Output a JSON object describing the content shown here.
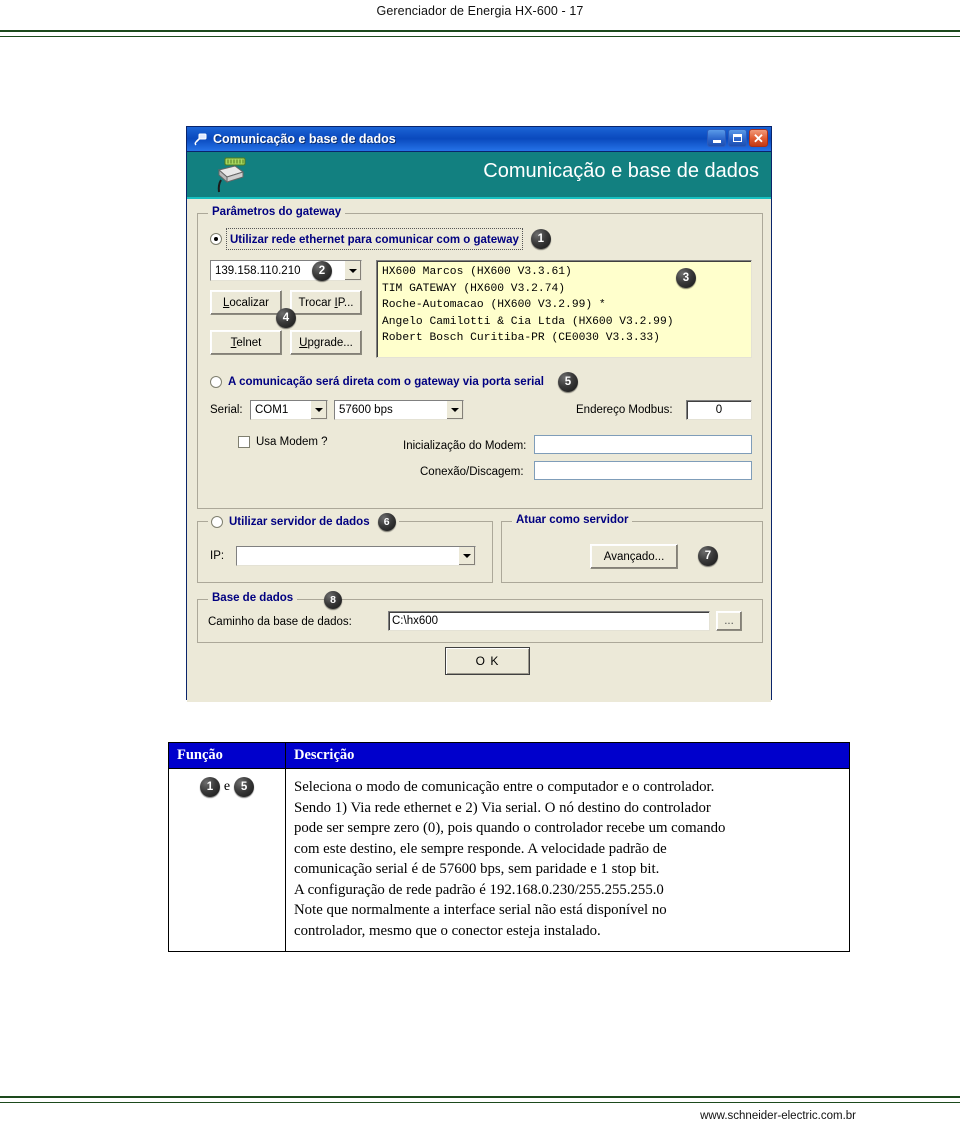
{
  "page": {
    "header_title": "Gerenciador de Energia HX-600 - 17",
    "footer_url": "www.schneider-electric.com.br"
  },
  "dialog": {
    "titlebar": {
      "title": "Comunicação e base de dados",
      "icon": "network-plug-icon",
      "minimize": "_",
      "maximize": "□",
      "close": "✕"
    },
    "banner": {
      "title": "Comunicação e base de dados",
      "icon": "modem-connector-icon"
    },
    "gateway_group": {
      "legend": "Parâmetros do gateway",
      "ethernet_radio": {
        "label": "Utilizar rede ethernet para comunicar com o gateway",
        "checked": true,
        "badge": "1"
      },
      "ip_combo": {
        "value": "139.158.110.210",
        "badge": "2"
      },
      "device_list": {
        "badge": "3",
        "items": [
          "HX600 Marcos (HX600 V3.3.61)",
          "TIM GATEWAY (HX600 V3.2.74)",
          "Roche-Automacao (HX600 V3.2.99) *",
          "Angelo Camilotti & Cia Ltda (HX600 V3.2.99)",
          "Robert Bosch Curitiba-PR (CE0030 V3.3.33)"
        ]
      },
      "buttons": {
        "badge": "4",
        "localizar": "Localizar",
        "trocar_ip": "Trocar IP...",
        "telnet": "Telnet",
        "upgrade": "Upgrade..."
      },
      "serial_radio": {
        "label": "A comunicação será direta com o gateway via porta serial",
        "checked": false,
        "badge": "5"
      },
      "serial_label": "Serial:",
      "serial_port": "COM1",
      "serial_baud": "57600 bps",
      "modbus_label": "Endereço Modbus:",
      "modbus_value": "0",
      "modem_checkbox_label": "Usa Modem ?",
      "modem_checked": false,
      "modem_init_label": "Inicialização do Modem:",
      "modem_init_value": "",
      "modem_dial_label": "Conexão/Discagem:",
      "modem_dial_value": ""
    },
    "data_server_group": {
      "legend": "Utilizar servidor de dados",
      "checked": false,
      "badge": "6",
      "ip_label": "IP:",
      "ip_value": ""
    },
    "act_as_server_group": {
      "legend": "Atuar como servidor",
      "advanced_button": "Avançado...",
      "badge": "7"
    },
    "database_group": {
      "legend": "Base de dados",
      "badge": "8",
      "path_label": "Caminho da base de dados:",
      "path_value": "C:\\hx600",
      "browse_button": "..."
    },
    "ok_button": "O K"
  },
  "table": {
    "headers": [
      "Função",
      "Descrição"
    ],
    "rows": [
      {
        "function_badges": [
          "1",
          "5"
        ],
        "function_separator": "e",
        "description_lines": [
          "Seleciona o modo de comunicação entre o computador e o controlador.",
          "Sendo 1) Via rede ethernet e 2) Via serial. O nó destino do controlador",
          "pode ser sempre zero (0), pois quando o controlador recebe um comando",
          "com este destino, ele sempre responde. A velocidade padrão de",
          "comunicação serial é de 57600 bps, sem paridade e 1 stop bit.",
          "A configuração de rede padrão é 192.168.0.230/255.255.255.0",
          "Note que normalmente a interface serial não está disponível no",
          "controlador, mesmo que o conector esteja instalado."
        ]
      }
    ]
  },
  "colors": {
    "titlebar_blue": "#0a49bd",
    "banner_teal": "#128080",
    "dialog_face": "#ece9d8",
    "list_yellow": "#ffffcc",
    "label_navy": "#000080",
    "table_header_blue": "#0000cc",
    "rule_green": "#1d4a1d"
  }
}
